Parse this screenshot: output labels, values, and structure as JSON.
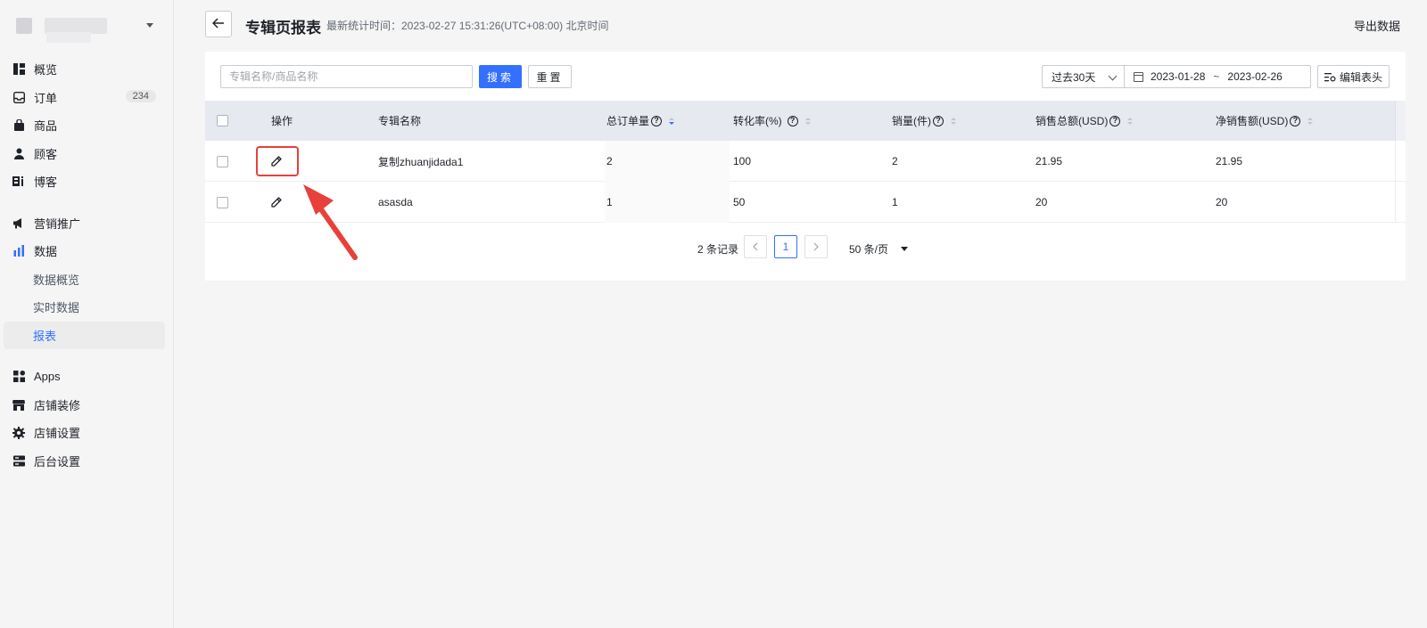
{
  "sidebar": {
    "items": [
      {
        "label": "概览",
        "icon": "overview-icon"
      },
      {
        "label": "订单",
        "icon": "inbox-icon",
        "badge": "234"
      },
      {
        "label": "商品",
        "icon": "bag-icon"
      },
      {
        "label": "顾客",
        "icon": "user-icon"
      },
      {
        "label": "博客",
        "icon": "blog-icon"
      }
    ],
    "marketing": {
      "label": "营销推广",
      "icon": "megaphone-icon"
    },
    "data": {
      "label": "数据",
      "icon": "bar-chart-icon",
      "children": [
        {
          "label": "数据概览"
        },
        {
          "label": "实时数据"
        },
        {
          "label": "报表",
          "active": true
        }
      ]
    },
    "bottom": [
      {
        "label": "Apps",
        "icon": "apps-icon"
      },
      {
        "label": "店铺装修",
        "icon": "storefront-icon"
      },
      {
        "label": "店铺设置",
        "icon": "gear-icon"
      },
      {
        "label": "后台设置",
        "icon": "server-icon"
      }
    ]
  },
  "header": {
    "title": "专辑页报表",
    "stat_time": "最新统计时间：2023-02-27 15:31:26(UTC+08:00) 北京时间",
    "export_label": "导出数据"
  },
  "toolbar": {
    "search_placeholder": "专辑名称/商品名称",
    "search_label": "搜索",
    "reset_label": "重置",
    "range_label": "过去30天",
    "date_start": "2023-01-28",
    "date_sep": "~",
    "date_end": "2023-02-26",
    "edit_header_label": "编辑表头"
  },
  "table": {
    "columns": {
      "action": "操作",
      "name": "专辑名称",
      "orders": "总订单量",
      "conversion": "转化率(%)",
      "sales": "销量(件)",
      "total_sales": "销售总额(USD)",
      "net_sales": "净销售额(USD)"
    },
    "rows": [
      {
        "name": "复制zhuanjidada1",
        "orders": "2",
        "conversion": "100",
        "sales": "2",
        "total_sales": "21.95",
        "net_sales": "21.95"
      },
      {
        "name": "asasda",
        "orders": "1",
        "conversion": "50",
        "sales": "1",
        "total_sales": "20",
        "net_sales": "20"
      }
    ]
  },
  "pagination": {
    "total": "2 条记录",
    "current": "1",
    "page_size": "50 条/页"
  },
  "colors": {
    "accent": "#3370ff",
    "highlight": "#e8413a",
    "header_bg": "#e7e9f1"
  }
}
